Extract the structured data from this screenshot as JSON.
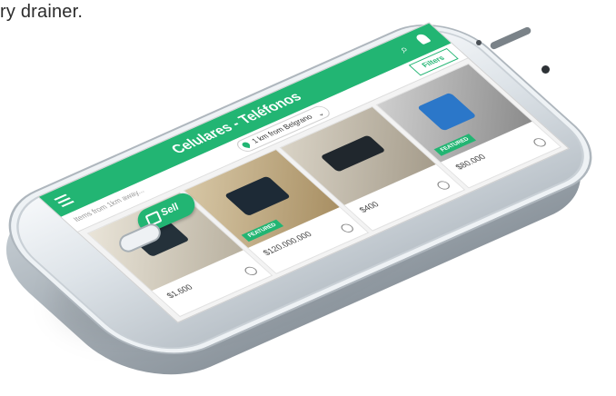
{
  "caption": "ry drainer.",
  "app": {
    "title": "Celulares - Teléfonos",
    "filter_hint": "Items from 1km away...",
    "location": "1 km from Belgrano",
    "filters_label": "Filters",
    "featured_label": "FEATURED",
    "sell_label": "Sell"
  },
  "listings": [
    {
      "price": "$1.600",
      "featured": false
    },
    {
      "price": "$120.000.000",
      "featured": true
    },
    {
      "price": "$400",
      "featured": false
    },
    {
      "price": "$80.000",
      "featured": true
    }
  ],
  "colors": {
    "accent": "#22b573"
  },
  "icons": [
    "menu-icon",
    "search-icon",
    "bell-icon",
    "pin-icon",
    "chevron-down-icon",
    "heart-icon",
    "camera-icon"
  ]
}
